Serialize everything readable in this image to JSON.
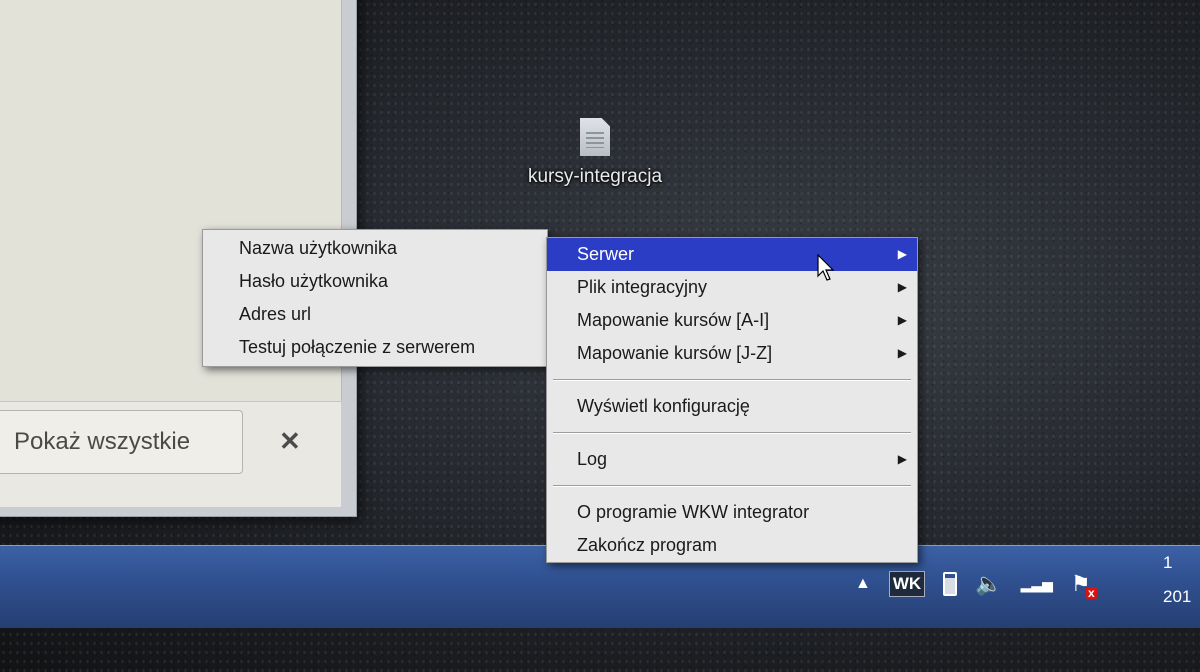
{
  "app_window": {
    "show_all_label": "Pokaż wszystkie",
    "close_symbol": "✕"
  },
  "desktop": {
    "icon_label": "kursy-integracja",
    "icon_name": "text-file-icon"
  },
  "context_menu": {
    "items": [
      {
        "label": "Serwer",
        "has_submenu": true,
        "highlighted": true
      },
      {
        "label": "Plik integracyjny",
        "has_submenu": true
      },
      {
        "label": "Mapowanie kursów [A-I]",
        "has_submenu": true
      },
      {
        "label": "Mapowanie kursów [J-Z]",
        "has_submenu": true
      },
      {
        "label": "Wyświetl konfigurację",
        "has_submenu": false
      },
      {
        "label": "Log",
        "has_submenu": true
      },
      {
        "label": "O programie WKW integrator",
        "has_submenu": false
      },
      {
        "label": "Zakończ program",
        "has_submenu": false
      }
    ],
    "submenu_arrow": "▶"
  },
  "server_submenu": {
    "items": [
      {
        "label": "Nazwa użytkownika"
      },
      {
        "label": "Hasło użytkownika"
      },
      {
        "label": "Adres url"
      },
      {
        "label": "Testuj połączenie z serwerem"
      }
    ]
  },
  "taskbar": {
    "tray_arrow": "▲",
    "wk_logo_text": "WK",
    "volume_glyph": "🔈",
    "signal_glyph": "▂▃▅",
    "clock_line1": "1",
    "clock_line2": "201"
  },
  "colors": {
    "menu_highlight": "#2b3dc4",
    "taskbar": "#2f4f8e"
  }
}
